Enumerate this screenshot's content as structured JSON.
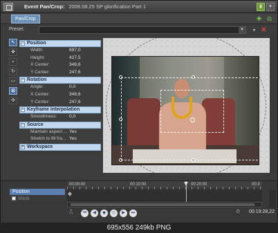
{
  "window": {
    "title": "Event Pan/Crop:",
    "subtitle": "2008.08.25 SP glorification Part 1"
  },
  "tabs": [
    {
      "label": "Pan/Crop"
    }
  ],
  "preset": {
    "label": "Preset:",
    "value": ""
  },
  "sections": [
    {
      "title": "Position",
      "rows": [
        {
          "label": "Width:",
          "value": "697,0"
        },
        {
          "label": "Height:",
          "value": "427,5"
        },
        {
          "label": "X Center:",
          "value": "348,6"
        },
        {
          "label": "Y Center:",
          "value": "247,6"
        }
      ]
    },
    {
      "title": "Rotation",
      "rows": [
        {
          "label": "Angle:",
          "value": "0,0"
        },
        {
          "label": "X Center:",
          "value": "348,6"
        },
        {
          "label": "Y Center:",
          "value": "247,6"
        }
      ]
    },
    {
      "title": "Keyframe interpolation",
      "rows": [
        {
          "label": "Smoothness:",
          "value": "0,0"
        }
      ]
    },
    {
      "title": "Source",
      "rows": [
        {
          "label": "Maintain aspect ...",
          "value": "Yes"
        },
        {
          "label": "Stretch to fill fra...",
          "value": "Yes"
        }
      ]
    },
    {
      "title": "Workspace",
      "rows": []
    }
  ],
  "timeline": {
    "tracks": [
      "Position",
      "Mask"
    ],
    "ruler": [
      "00:00:00",
      "00:10:00",
      "00:20:00",
      "00:3"
    ],
    "timecode": "00:19:28,22"
  },
  "caption": "695x556 249kb PNG",
  "colors": {
    "section_bg": "#c3d7ee",
    "selected_track": "#5b7fb0",
    "viewport_bg": "#d6d6d6"
  }
}
